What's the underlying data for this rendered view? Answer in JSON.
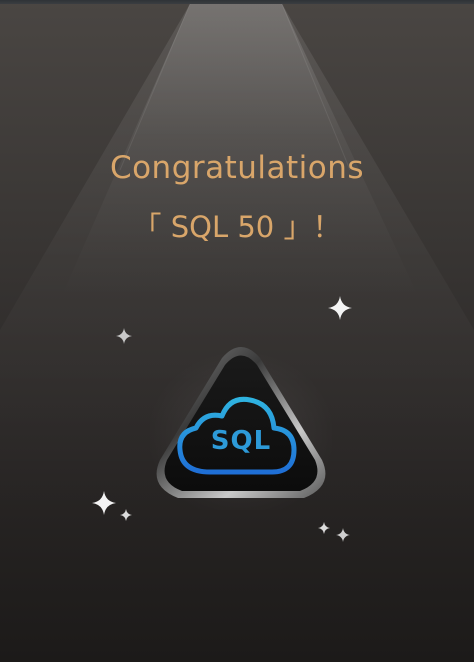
{
  "dialog": {
    "congrats_text": "Congratulations",
    "badge_name": "「 SQL 50 」！"
  },
  "badge": {
    "icon": "cloud-icon",
    "label": "SQL",
    "accent_color": "#2d9ad8"
  },
  "colors": {
    "title": "#d9a66a",
    "background_top": "#4a4643",
    "background_bottom": "#1c1a19"
  }
}
